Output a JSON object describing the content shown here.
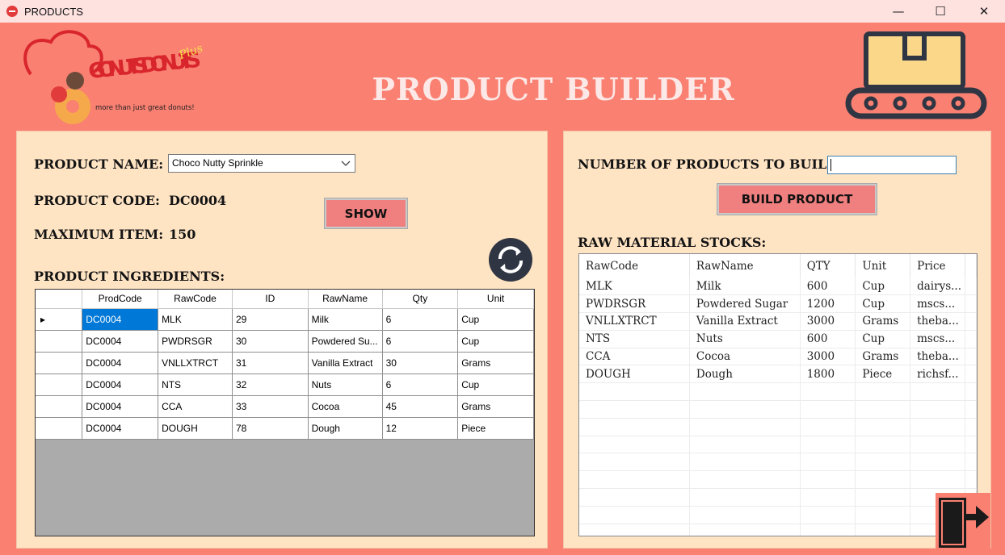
{
  "window": {
    "title": "PRODUCTS"
  },
  "header": {
    "title": "PRODUCT BUILDER",
    "logo_text": "GO NUTS DONUTS",
    "logo_tagline": "more than just great donuts!",
    "logo_script": "Plus"
  },
  "left": {
    "product_name_label": "PRODUCT NAME:",
    "product_name_value": "Choco Nutty Sprinkle",
    "product_code_label": "PRODUCT CODE:",
    "product_code_value": "DC0004",
    "max_item_label": "MAXIMUM ITEM:",
    "max_item_value": "150",
    "show_label": "SHOW",
    "ingredients_label": "PRODUCT INGREDIENTS:",
    "ingredients": {
      "columns": [
        "ProdCode",
        "RawCode",
        "ID",
        "RawName",
        "Qty",
        "Unit"
      ],
      "rows": [
        [
          "DC0004",
          "MLK",
          "29",
          "Milk",
          "6",
          "Cup"
        ],
        [
          "DC0004",
          "PWDRSGR",
          "30",
          "Powdered Su...",
          "6",
          "Cup"
        ],
        [
          "DC0004",
          "VNLLXTRCT",
          "31",
          "Vanilla Extract",
          "30",
          "Grams"
        ],
        [
          "DC0004",
          "NTS",
          "32",
          "Nuts",
          "6",
          "Cup"
        ],
        [
          "DC0004",
          "CCA",
          "33",
          "Cocoa",
          "45",
          "Grams"
        ],
        [
          "DC0004",
          "DOUGH",
          "78",
          "Dough",
          "12",
          "Piece"
        ]
      ]
    }
  },
  "right": {
    "num_products_label": "NUMBER OF PRODUCTS TO BUILD:",
    "num_products_value": "",
    "build_label": "BUILD PRODUCT",
    "stocks_label": "RAW MATERIAL STOCKS:",
    "stocks": {
      "columns": [
        "RawCode",
        "RawName",
        "QTY",
        "Unit",
        "Price"
      ],
      "rows": [
        [
          "MLK",
          "Milk",
          "600",
          "Cup",
          "dairys..."
        ],
        [
          "PWDRSGR",
          "Powdered Sugar",
          "1200",
          "Cup",
          "mscs..."
        ],
        [
          "VNLLXTRCT",
          "Vanilla Extract",
          "3000",
          "Grams",
          "theba..."
        ],
        [
          "NTS",
          "Nuts",
          "600",
          "Cup",
          "mscs..."
        ],
        [
          "CCA",
          "Cocoa",
          "3000",
          "Grams",
          "theba..."
        ],
        [
          "DOUGH",
          "Dough",
          "1800",
          "Piece",
          "richsf..."
        ]
      ]
    }
  },
  "colors": {
    "background": "#fa8072",
    "panel": "#ffe4c4",
    "button": "#f08080",
    "selection": "#0078d7"
  },
  "icons": [
    "refresh-icon",
    "exit-door-icon",
    "conveyor-box-icon",
    "chevron-down-icon"
  ]
}
